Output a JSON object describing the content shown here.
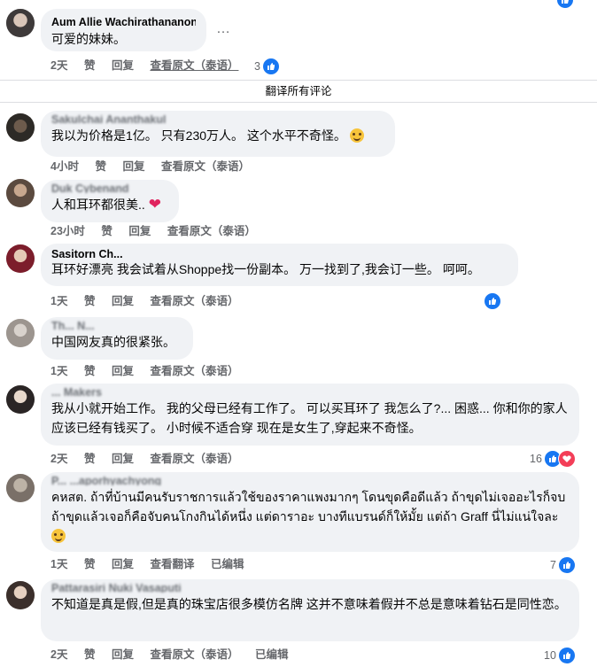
{
  "comments": [
    {
      "author": "Aum Allie Wachirathananon",
      "text": "可爱的妹妹。",
      "time": "2天",
      "like": "赞",
      "reply": "回复",
      "see_original": "查看原文（泰语）",
      "reaction_count": "3",
      "more": "…"
    },
    {
      "author": "Sakulchai Ananthakul",
      "text": "我以为价格是1亿。 只有230万人。 这个水平不奇怪。",
      "time": "4小时",
      "like": "赞",
      "reply": "回复",
      "see_original": "查看原文（泰语）"
    },
    {
      "author": "Duk Cybenand",
      "text": "人和耳环都很美..",
      "time": "23小时",
      "like": "赞",
      "reply": "回复",
      "see_original": "查看原文（泰语）"
    },
    {
      "author": "Sasitorn Ch...",
      "text": "耳环好漂亮 我会试着从Shoppe找一份副本。 万一找到了,我会订一些。 呵呵。",
      "time": "1天",
      "like": "赞",
      "reply": "回复",
      "see_original": "查看原文（泰语）"
    },
    {
      "author": "Th... N...",
      "text": "中国网友真的很紧张。",
      "time": "1天",
      "like": "赞",
      "reply": "回复",
      "see_original": "查看原文（泰语）"
    },
    {
      "author": "... Makers",
      "text": "我从小就开始工作。 我的父母已经有工作了。 可以买耳环了 我怎么了?... 困惑... 你和你的家人应该已经有钱买了。 小时候不适合穿 现在是女生了,穿起来不奇怪。",
      "time": "2天",
      "like": "赞",
      "reply": "回复",
      "see_original": "查看原文（泰语）",
      "reaction_count": "16"
    },
    {
      "author": "P... ...aporhyachyong",
      "text": "คหสต. ถ้าที่บ้านมีคนรับราชการแล้วใช้ของราคาแพงมากๆ โดนขุดคือดีแล้ว ถ้าขุดไม่เจออะไรก็จบ ถ้าขุดแล้วเจอก็คือจับคนโกงกินได้หนึ่ง แต่ดาราอะ บางทีแบรนด์ก็ให้มั้ย แต่ถ้า Graff นี่ไม่แน่ใจละ",
      "time": "1天",
      "like": "赞",
      "reply": "回复",
      "see_translation": "查看翻译",
      "edited": "已编辑",
      "reaction_count": "7"
    },
    {
      "author": "Pattarasiri Nuki Vasaputi",
      "text": "不知道是真是假,但是真的珠宝店很多模仿名牌 这并不意味着假并不总是意味着钻石是同性恋。",
      "time": "2天",
      "like": "赞",
      "reply": "回复",
      "see_original": "查看原文（泰语）",
      "edited": "已编辑",
      "reaction_count": "10"
    }
  ],
  "translate_all": "翻译所有评论",
  "colors": {
    "like_blue": "#1877f2",
    "love_red": "#f33e58",
    "bubble": "#f0f2f5",
    "meta": "#65676b"
  }
}
